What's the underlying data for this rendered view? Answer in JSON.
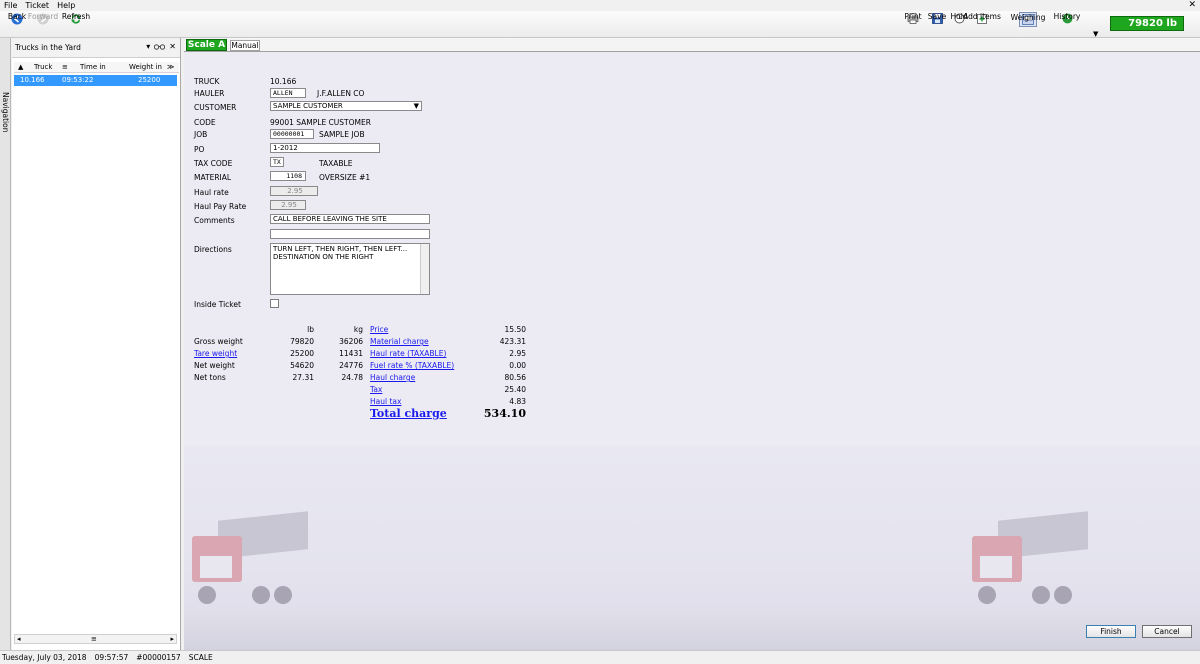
{
  "menu": [
    "File",
    "Ticket",
    "Help"
  ],
  "toolbar": {
    "back": "Back",
    "forward": "Forward",
    "refresh": "Refresh",
    "print": "Print",
    "save": "Save",
    "hold": "Hold",
    "add_items": "Add items",
    "weighing": "Weighing",
    "history": "History",
    "weight_display": "79820 lb"
  },
  "navigation": {
    "label": "Navigation"
  },
  "trucks_panel": {
    "title": "Trucks in the Yard",
    "columns": [
      "Truck",
      "Time in",
      "Weight in"
    ],
    "rows": [
      {
        "truck": "10.166",
        "time_in": "09:53:22",
        "weight_in": "25200"
      }
    ]
  },
  "tabs": {
    "scale": "Scale A",
    "manual": "Manual"
  },
  "form": {
    "truck_label": "TRUCK",
    "truck_value": "10.166",
    "hauler_label": "HAULER",
    "hauler_code": "ALLEN",
    "hauler_name": "J.F.ALLEN CO",
    "customer_label": "CUSTOMER",
    "customer_value": "SAMPLE CUSTOMER",
    "code_label": "CODE",
    "code_value": "99001 SAMPLE CUSTOMER",
    "job_label": "JOB",
    "job_code": "00000001",
    "job_name": "SAMPLE JOB",
    "po_label": "PO",
    "po_value": "1-2012",
    "tax_code_label": "TAX CODE",
    "tax_code": "TX",
    "tax_code_name": "TAXABLE",
    "material_label": "MATERIAL",
    "material_code": "1108",
    "material_name": "OVERSIZE #1",
    "haul_rate_label": "Haul rate",
    "haul_rate_value": "2.95",
    "haul_pay_rate_label": "Haul Pay Rate",
    "haul_pay_rate_value": "2.95",
    "comments_label": "Comments",
    "comments_value": "CALL BEFORE LEAVING THE SITE",
    "comments_value2": "",
    "directions_label": "Directions",
    "directions_line1": "TURN LEFT, THEN RIGHT,  THEN LEFT...",
    "directions_line2": "DESTINATION ON THE RIGHT",
    "inside_ticket_label": "Inside Ticket"
  },
  "weights": {
    "unit_lb": "lb",
    "unit_kg": "kg",
    "gross_label": "Gross weight",
    "gross_lb": "79820",
    "gross_kg": "36206",
    "tare_label": "Tare weight",
    "tare_lb": "25200",
    "tare_kg": "11431",
    "net_label": "Net weight",
    "net_lb": "54620",
    "net_kg": "24776",
    "tons_label": "Net tons",
    "tons_lb": "27.31",
    "tons_kg": "24.78"
  },
  "charges": {
    "price_label": "Price",
    "price": "15.50",
    "material_label": "Material charge",
    "material": "423.31",
    "haul_rate_label": "Haul rate (TAXABLE)",
    "haul_rate": "2.95",
    "fuel_rate_label": "Fuel rate % (TAXABLE)",
    "fuel_rate": "0.00",
    "haul_charge_label": "Haul charge",
    "haul_charge": "80.56",
    "tax_label": "Tax",
    "tax": "25.40",
    "haul_tax_label": "Haul tax",
    "haul_tax": "4.83",
    "total_label": "Total charge",
    "total": "534.10"
  },
  "buttons": {
    "finish": "Finish",
    "cancel": "Cancel"
  },
  "status": {
    "date": "Tuesday, July 03, 2018",
    "time": "09:57:57",
    "ticket": "#00000157",
    "mode": "SCALE"
  },
  "colors": {
    "accent_green": "#1ea61e",
    "selection_blue": "#3399ff",
    "link_blue": "#1a1aee"
  }
}
